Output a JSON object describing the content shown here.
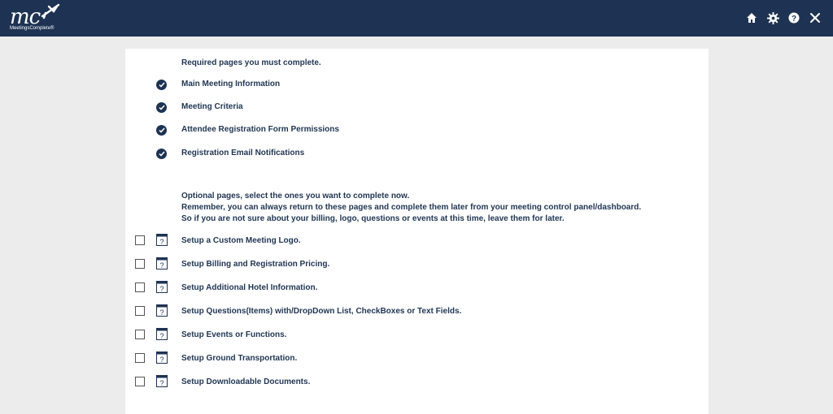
{
  "header": {
    "logo_mark": "mc",
    "logo_text": "MeetingsComplete®",
    "icons": [
      "home-icon",
      "gear-icon",
      "help-icon",
      "close-icon"
    ],
    "color": "#1e3353"
  },
  "required": {
    "heading": "Required pages you must complete.",
    "items": [
      "Main Meeting Information",
      "Meeting Criteria",
      "Attendee Registration Form Permissions",
      "Registration Email Notifications"
    ]
  },
  "optional": {
    "heading_lines": [
      "Optional pages, select the ones you want to complete now.",
      "Remember, you can always return to these pages and complete them later from your meeting control panel/dashboard.",
      "So if you are not sure about your billing, logo, questions or events at this time, leave them for later."
    ],
    "items": [
      "Setup a Custom Meeting Logo.",
      "Setup Billing and Registration Pricing.",
      "Setup Additional Hotel Information.",
      "Setup Questions(Items) with/DropDown List, CheckBoxes or Text Fields.",
      "Setup Events or Functions.",
      "Setup Ground Transportation.",
      "Setup Downloadable Documents."
    ]
  }
}
